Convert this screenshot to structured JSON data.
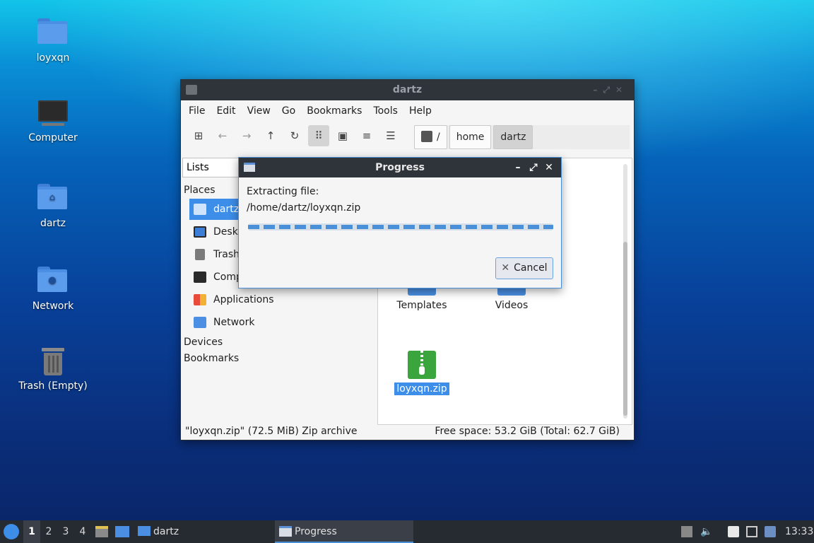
{
  "desktop": {
    "icons": [
      {
        "label": "loyxqn",
        "icon": "folder-icon"
      },
      {
        "label": "Computer",
        "icon": "computer-icon"
      },
      {
        "label": "dartz",
        "icon": "home-folder-icon"
      },
      {
        "label": "Network",
        "icon": "network-folder-icon"
      },
      {
        "label": "Trash (Empty)",
        "icon": "trash-icon"
      }
    ]
  },
  "window": {
    "title": "dartz",
    "menu": [
      "File",
      "Edit",
      "View",
      "Go",
      "Bookmarks",
      "Tools",
      "Help"
    ],
    "path": [
      "/",
      "home",
      "dartz"
    ],
    "side_select": "Lists",
    "side": {
      "places_header": "Places",
      "places": [
        "dartz",
        "Desktop",
        "Trash",
        "Computer",
        "Applications",
        "Network"
      ],
      "devices_header": "Devices",
      "bookmarks_header": "Bookmarks"
    },
    "files": [
      {
        "label": "Templates",
        "icon": "templates-folder-icon"
      },
      {
        "label": "Videos",
        "icon": "videos-folder-icon"
      },
      {
        "label": "loyxqn.zip",
        "icon": "zip-archive-icon"
      }
    ],
    "status_left": "\"loyxqn.zip\" (72.5 MiB) Zip archive",
    "status_right": "Free space: 53.2 GiB (Total: 62.7 GiB)"
  },
  "dialog": {
    "title": "Progress",
    "line1": "Extracting file:",
    "line2": "/home/dartz/loyxqn.zip",
    "cancel_label": "Cancel"
  },
  "taskbar": {
    "workspaces": [
      "1",
      "2",
      "3",
      "4"
    ],
    "tasks": [
      {
        "label": "dartz",
        "icon": "folder-icon"
      },
      {
        "label": "Progress",
        "icon": "window-icon"
      }
    ],
    "clock": "13:33"
  },
  "colors": {
    "accent": "#4a90d9",
    "selection": "#3d8ee8",
    "titlebar": "#2f333a",
    "zip_icon": "#3aa53c"
  }
}
